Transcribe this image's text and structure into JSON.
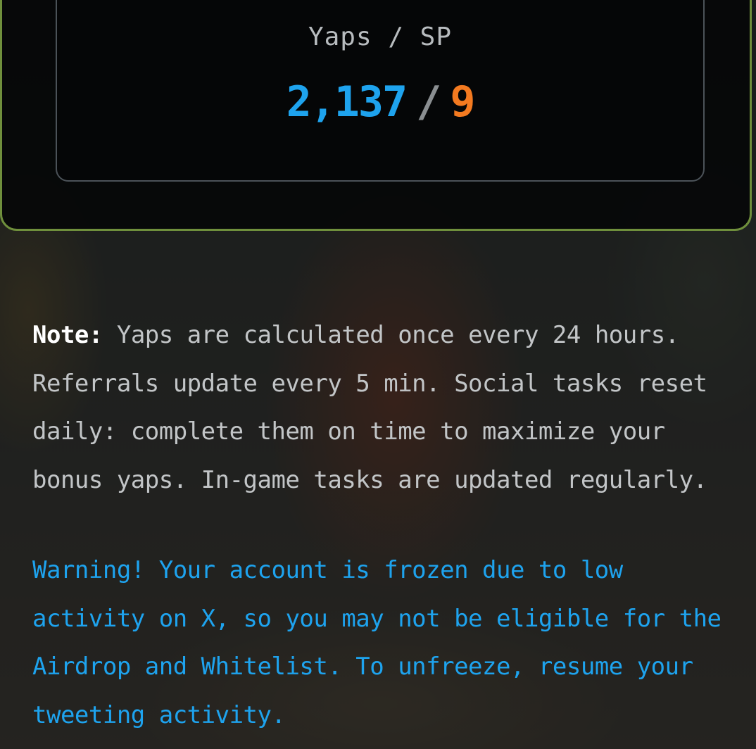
{
  "stats": {
    "label": "Yaps / SP",
    "yaps_value": "2,137",
    "separator": "/",
    "sp_value": "9"
  },
  "note": {
    "label": "Note:",
    "text": "Yaps are calculated once every 24 hours. Referrals update every 5 min. Social tasks reset daily: complete them on time to maximize your bonus yaps. In-game tasks are updated regularly."
  },
  "warning": {
    "text": "Warning! Your account is frozen due to low activity on X, so you may not be eligible for the Airdrop and Whitelist. To unfreeze, resume your tweeting activity."
  },
  "colors": {
    "accent_blue": "#1ea3ee",
    "accent_orange": "#f47a20",
    "card_border_green": "#6f8f3c"
  }
}
